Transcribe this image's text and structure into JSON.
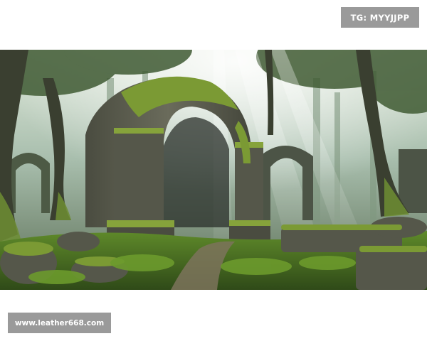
{
  "top_badge": {
    "text": "TG: MYYJJPP"
  },
  "bottom_badge": {
    "text": "www.leather668.com"
  },
  "scene": {
    "subject": "mossy stone arch ruins in sunlit forest",
    "colors": {
      "sky_light": "#e9efe2",
      "haze": "#a9bfae",
      "tree_dark": "#2f3a2c",
      "stone": "#5c5d50",
      "moss": "#7b9a34",
      "grass": "#4f7d22",
      "path": "#7d735c"
    }
  }
}
